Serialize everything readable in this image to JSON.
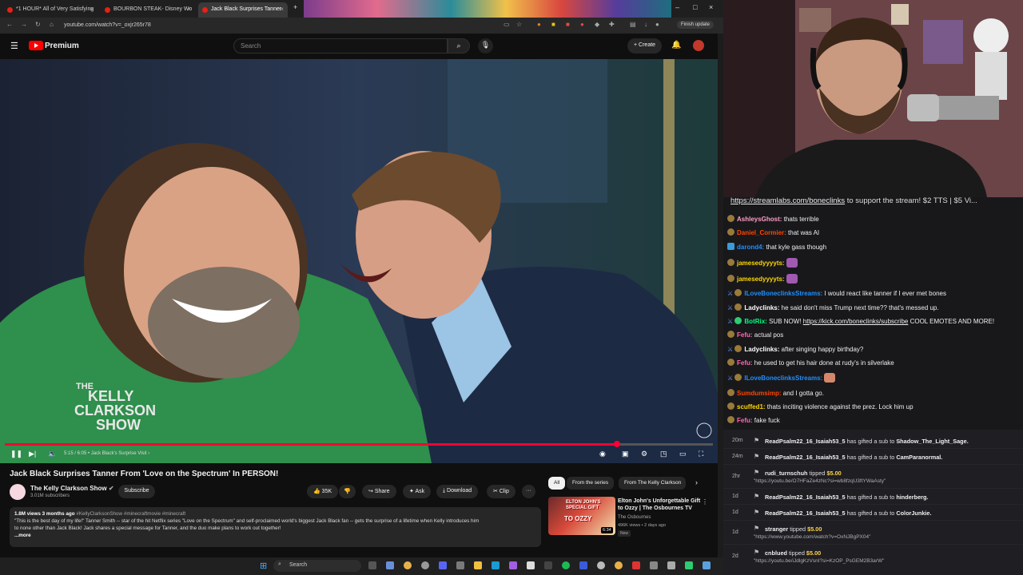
{
  "browser": {
    "tabs": [
      {
        "title": "*1 HOUR* All of Very Satisfying"
      },
      {
        "title": "BOURBON STEAK- Disney Wo"
      },
      {
        "title": "Jack Black Surprises Tanner"
      }
    ],
    "url": "youtube.com/watch?v=_oxjr265r78",
    "finish_update": "Finish update"
  },
  "youtube": {
    "brand": "Premium",
    "search_placeholder": "Search",
    "create_label": "Create",
    "video": {
      "time": "5:15 / 6:05",
      "chapter": "Jack Black's Surprise Visit",
      "progress": 0.864,
      "show_logo": [
        "THE",
        "KELLY",
        "CLARKSON",
        "SHOW"
      ]
    },
    "title": "Jack Black Surprises Tanner From 'Love on the Spectrum' In PERSON!",
    "channel": {
      "name": "The Kelly Clarkson Show",
      "subscribers": "3.01M subscribers",
      "subscribe": "Subscribe"
    },
    "actions": {
      "likes": "35K",
      "share": "Share",
      "ask": "Ask",
      "download": "Download",
      "clip": "Clip",
      "more": "···"
    },
    "description": {
      "views": "1.8M views",
      "ago": "3 months ago",
      "tags": "#KellyClarksonShow #minecraftmovie #minecraft",
      "line1": "\"This is the best day of my life!\" Tanner Smith -- star of the hit Netflix series \"Love on the Spectrum\" and self-proclaimed world's biggest Jack Black fan -- gets the surprise of a lifetime when Kelly introduces him",
      "line2": "to none other than Jack Black! Jack shares a special message for Tanner, and the duo make plans to work out together!",
      "more": "...more"
    },
    "chips": [
      "All",
      "From the series",
      "From The Kelly Clarkson"
    ],
    "recommendation": {
      "title": "Elton John's Unforgettable Gift to Ozzy | The Osbournes TV",
      "channel": "The Osbournes",
      "views": "496K views • 2 days ago",
      "badge": "New",
      "duration": "6:34",
      "thumb_text": [
        "ELTON JOHN'S",
        "SPECIAL GIFT",
        "TO OZZY"
      ]
    }
  },
  "taskbar": {
    "search": "Search"
  },
  "stream": {
    "banner_link": "https://streamlabs.com/boneclinks",
    "banner_text": " to support the stream! $2 TTS | $5 Vi...",
    "chat": [
      {
        "user": "AshleysGhost:",
        "text": " thats terrible",
        "color": "#ff9ec4"
      },
      {
        "user": "Daniel_Cormier:",
        "text": " that was AI",
        "color": "#ff4500"
      },
      {
        "user": "darond4:",
        "text": " that kyle gass though",
        "color": "#1e90ff"
      },
      {
        "user": "jamesedyyyyts:",
        "text": "",
        "color": "#ffd700"
      },
      {
        "user": "jamesedyyyyts:",
        "text": "",
        "color": "#ffd700"
      },
      {
        "user": "ILoveBoneclinksStreams:",
        "text": " I would react like tanner if I ever met bones",
        "color": "#1e90ff"
      },
      {
        "user": "Ladyclinks:",
        "text": " he said don't miss Trump next time?? that's messed up.",
        "color": "#ffffff"
      },
      {
        "user": "BotRix:",
        "text": " SUB NOW! ",
        "link": "https://kick.com/boneclinks/subscribe",
        "tail": " COOL EMOTES AND MORE!",
        "color": "#00ff7f"
      },
      {
        "user": "Fefu:",
        "text": " actual pos",
        "color": "#ff69b4"
      },
      {
        "user": "Ladyclinks:",
        "text": " after singing happy birthday?",
        "color": "#ffffff"
      },
      {
        "user": "Fefu:",
        "text": " he used to get his hair done at rudy's in silverlake",
        "color": "#ff69b4"
      },
      {
        "user": "ILoveBoneclinksStreams:",
        "text": "",
        "color": "#1e90ff"
      },
      {
        "user": "Sumdumsimp:",
        "text": " and I gotta go.",
        "color": "#ff4500"
      },
      {
        "user": "scuffed1:",
        "text": " thats inciting violence against the prez. Lock him up",
        "color": "#ffd700"
      },
      {
        "user": "Fefu:",
        "text": " fake fuck",
        "color": "#ff69b4"
      }
    ],
    "events": [
      {
        "time": "20m",
        "user": "ReadPsalm22_16_Isaiah53_5",
        "mid": " has gifted a sub to ",
        "target": "Shadow_The_Light_Sage."
      },
      {
        "time": "24m",
        "user": "ReadPsalm22_16_Isaiah53_5",
        "mid": " has gifted a sub to ",
        "target": "CamParanormal."
      },
      {
        "time": "2hr",
        "user": "rudi_turnschuh",
        "mid": " tipped ",
        "amount": "$5.00",
        "link": "\"https://youtu.be/O7HFaZe4zNc?si=wb8fzqU3ftYWaAsty\""
      },
      {
        "time": "1d",
        "user": "ReadPsalm22_16_Isaiah53_5",
        "mid": " has gifted a sub to ",
        "target": "hinderberg."
      },
      {
        "time": "1d",
        "user": "ReadPsalm22_16_Isaiah53_5",
        "mid": " has gifted a sub to ",
        "target": "ColorJunkie."
      },
      {
        "time": "1d",
        "user": "stranger",
        "mid": " tipped ",
        "amount": "$5.00",
        "link": "\"https://www.youtube.com/watch?v=OxNJBgPX04\""
      },
      {
        "time": "2d",
        "user": "cnblued",
        "mid": " tipped ",
        "amount": "$5.00",
        "link": "\"https://youtu.be/iJdlgKzVsnI?si=KzOP_PsGEM2B3arW\""
      }
    ]
  }
}
